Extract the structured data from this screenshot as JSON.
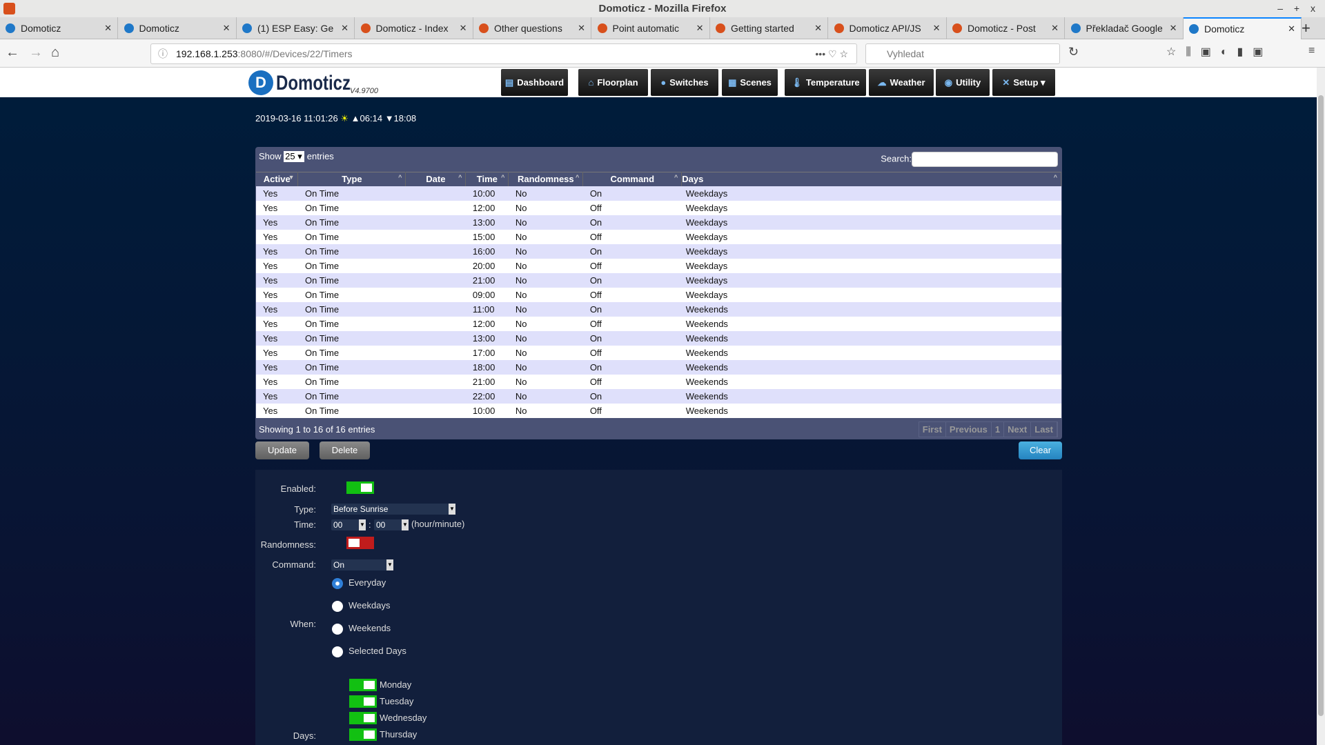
{
  "window": {
    "title": "Domoticz - Mozilla Firefox",
    "controls": "– + x"
  },
  "tabs": [
    {
      "label": "Domoticz",
      "icon": "domoticz-icon"
    },
    {
      "label": "Domoticz",
      "icon": "domoticz-icon"
    },
    {
      "label": "(1) ESP Easy: Ge",
      "icon": "esp-icon"
    },
    {
      "label": "Domoticz - Index",
      "icon": "domoticz-icon"
    },
    {
      "label": "Other questions",
      "icon": "domoticz-icon"
    },
    {
      "label": "Point automatic",
      "icon": "domoticz-icon"
    },
    {
      "label": "Getting started",
      "icon": "domoticz-icon"
    },
    {
      "label": "Domoticz API/JS",
      "icon": "domoticz-icon"
    },
    {
      "label": "Domoticz - Post",
      "icon": "domoticz-icon"
    },
    {
      "label": "Překladač Google",
      "icon": "translate-icon"
    },
    {
      "label": "Domoticz",
      "icon": "domoticz-icon",
      "active": true
    }
  ],
  "url": {
    "host": "192.168.1.253",
    "rest": ":8080/#/Devices/22/Timers"
  },
  "search_placeholder": "Vyhledat",
  "app": {
    "logo": "Domoticz",
    "version": "V4.9700"
  },
  "menu": [
    {
      "label": "Dashboard"
    },
    {
      "label": "Floorplan"
    },
    {
      "label": "Switches"
    },
    {
      "label": "Scenes"
    },
    {
      "label": "Temperature"
    },
    {
      "label": "Weather"
    },
    {
      "label": "Utility"
    },
    {
      "label": "Setup ▾"
    }
  ],
  "clock": {
    "datetime": "2019-03-16 11:01:26",
    "sunrise": "▲06:14",
    "sunset": "▼18:08"
  },
  "table": {
    "show": "Show",
    "show_value": "25",
    "entries": "entries",
    "search_label": "Search:",
    "columns": [
      "Active",
      "Type",
      "Date",
      "Time",
      "Randomness",
      "Command",
      "Days"
    ],
    "rows": [
      [
        "Yes",
        "On Time",
        "",
        "10:00",
        "No",
        "On",
        "Weekdays"
      ],
      [
        "Yes",
        "On Time",
        "",
        "12:00",
        "No",
        "Off",
        "Weekdays"
      ],
      [
        "Yes",
        "On Time",
        "",
        "13:00",
        "No",
        "On",
        "Weekdays"
      ],
      [
        "Yes",
        "On Time",
        "",
        "15:00",
        "No",
        "Off",
        "Weekdays"
      ],
      [
        "Yes",
        "On Time",
        "",
        "16:00",
        "No",
        "On",
        "Weekdays"
      ],
      [
        "Yes",
        "On Time",
        "",
        "20:00",
        "No",
        "Off",
        "Weekdays"
      ],
      [
        "Yes",
        "On Time",
        "",
        "21:00",
        "No",
        "On",
        "Weekdays"
      ],
      [
        "Yes",
        "On Time",
        "",
        "09:00",
        "No",
        "Off",
        "Weekdays"
      ],
      [
        "Yes",
        "On Time",
        "",
        "11:00",
        "No",
        "On",
        "Weekends"
      ],
      [
        "Yes",
        "On Time",
        "",
        "12:00",
        "No",
        "Off",
        "Weekends"
      ],
      [
        "Yes",
        "On Time",
        "",
        "13:00",
        "No",
        "On",
        "Weekends"
      ],
      [
        "Yes",
        "On Time",
        "",
        "17:00",
        "No",
        "Off",
        "Weekends"
      ],
      [
        "Yes",
        "On Time",
        "",
        "18:00",
        "No",
        "On",
        "Weekends"
      ],
      [
        "Yes",
        "On Time",
        "",
        "21:00",
        "No",
        "Off",
        "Weekends"
      ],
      [
        "Yes",
        "On Time",
        "",
        "22:00",
        "No",
        "On",
        "Weekends"
      ],
      [
        "Yes",
        "On Time",
        "",
        "10:00",
        "No",
        "Off",
        "Weekends"
      ]
    ],
    "info": "Showing 1 to 16 of 16 entries",
    "pager": [
      "First",
      "Previous",
      "1",
      "Next",
      "Last"
    ]
  },
  "buttons": {
    "update": "Update",
    "delete": "Delete",
    "clear": "Clear"
  },
  "form": {
    "enabled_label": "Enabled:",
    "enabled": true,
    "type_label": "Type:",
    "type_value": "Before Sunrise",
    "time_label": "Time:",
    "hour": "00",
    "minute": "00",
    "time_sep": ":",
    "time_hint": "(hour/minute)",
    "randomness_label": "Randomness:",
    "randomness": false,
    "command_label": "Command:",
    "command_value": "On",
    "when_label": "When:",
    "when_options": [
      {
        "label": "Everyday",
        "checked": true
      },
      {
        "label": "Weekdays"
      },
      {
        "label": "Weekends"
      },
      {
        "label": "Selected Days"
      }
    ],
    "days_label": "Days:",
    "days": [
      {
        "label": "Monday",
        "on": true
      },
      {
        "label": "Tuesday",
        "on": true
      },
      {
        "label": "Wednesday",
        "on": true
      },
      {
        "label": "Thursday",
        "on": true
      }
    ]
  },
  "colors": {
    "accent": "#2584c0",
    "toggle_on": "#12c012",
    "toggle_off": "#c01c1c",
    "bg": "#0a1430"
  }
}
